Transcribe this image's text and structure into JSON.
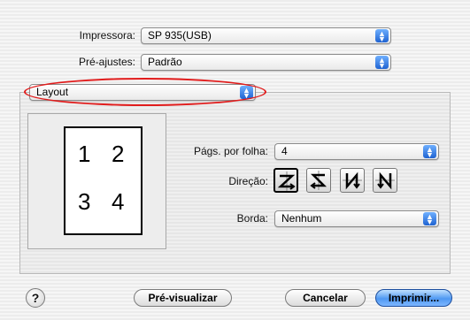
{
  "printer": {
    "label": "Impressora:",
    "value": "SP 935(USB)"
  },
  "presets": {
    "label": "Pré-ajustes:",
    "value": "Padrão"
  },
  "panel_menu": {
    "value": "Layout"
  },
  "layout": {
    "pages_per_sheet": {
      "label": "Págs. por folha:",
      "value": "4"
    },
    "direction": {
      "label": "Direção:",
      "options": [
        "z-order",
        "reverse-z-order",
        "n-order",
        "reverse-n-order"
      ],
      "selected": "z-order"
    },
    "border": {
      "label": "Borda:",
      "value": "Nenhum"
    },
    "preview_numbers": [
      "1",
      "2",
      "3",
      "4"
    ]
  },
  "buttons": {
    "help": "?",
    "preview": "Pré-visualizar",
    "cancel": "Cancelar",
    "print": "Imprimir..."
  },
  "colors": {
    "highlight": "#e11b1b",
    "accent": "#2f74e0"
  }
}
